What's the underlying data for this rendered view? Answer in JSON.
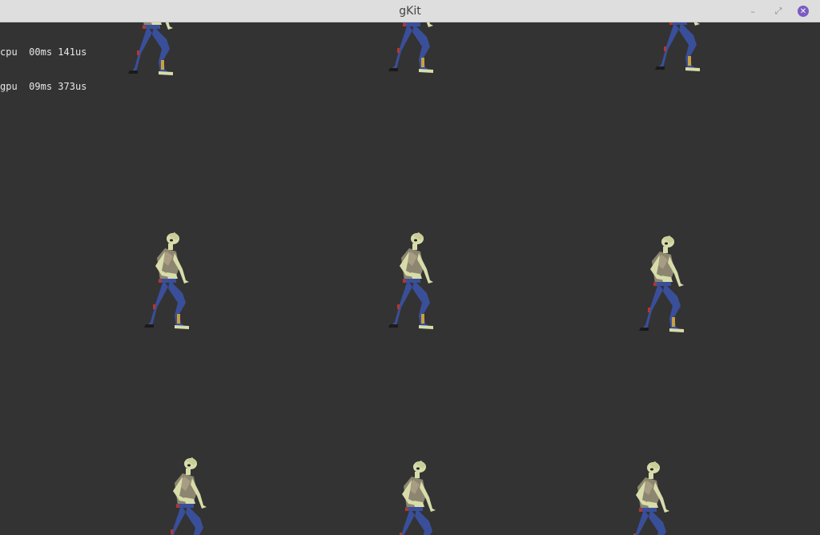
{
  "window": {
    "title": "gKit",
    "minimize_symbol": "–",
    "maximize_symbol": "⤢",
    "close_symbol": "✕",
    "close_color": "#7b5cc2"
  },
  "stats": {
    "cpu_label": "cpu",
    "cpu_value": "00ms 141us",
    "gpu_label": "gpu",
    "gpu_value": "09ms 373us"
  },
  "scene": {
    "background": "#333333",
    "colors": {
      "skin": "#d8dcaa",
      "shirt": "#8c8670",
      "jeans": "#3a4f9a",
      "wound": "#b8352a",
      "shoe": "#1a1a1a",
      "shadow": "#222222"
    }
  }
}
